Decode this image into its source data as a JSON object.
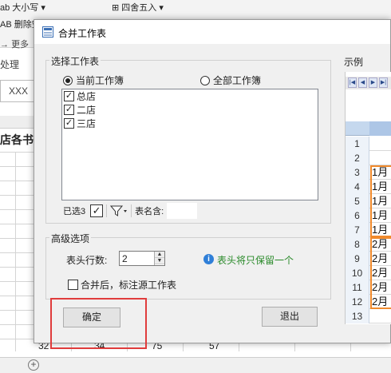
{
  "background": {
    "ribbon": {
      "size_label": "大小写",
      "rounding_label": "四舍五入",
      "delete_label": "删除空",
      "more_label": "更多",
      "process_label": "处理"
    },
    "name_box": "XXX",
    "sheet_title_fragment": "店各书",
    "last_row": [
      "32",
      "34",
      "75",
      "57"
    ]
  },
  "dialog": {
    "title": "合并工作表",
    "select_group": {
      "title": "选择工作表",
      "radio_current": "当前工作簿",
      "radio_all": "全部工作簿",
      "selected_radio": "current",
      "sheets": [
        {
          "label": "总店",
          "checked": true
        },
        {
          "label": "二店",
          "checked": true
        },
        {
          "label": "三店",
          "checked": true
        }
      ],
      "selected_count": "已选3",
      "filter_label": "表名含:",
      "filter_value": ""
    },
    "advanced_group": {
      "title": "高级选项",
      "header_rows_label": "表头行数:",
      "header_rows_value": "2",
      "info_text": "表头将只保留一个",
      "annotate_label": "合并后，标注源工作表",
      "annotate_checked": false
    },
    "ok_label": "确定",
    "exit_label": "退出",
    "example": {
      "title": "示例",
      "rows": [
        {
          "n": "1",
          "v": ""
        },
        {
          "n": "2",
          "v": ""
        },
        {
          "n": "3",
          "v": "1月"
        },
        {
          "n": "4",
          "v": "1月"
        },
        {
          "n": "5",
          "v": "1月"
        },
        {
          "n": "6",
          "v": "1月"
        },
        {
          "n": "7",
          "v": "1月"
        },
        {
          "n": "8",
          "v": "2月"
        },
        {
          "n": "9",
          "v": "2月"
        },
        {
          "n": "10",
          "v": "2月"
        },
        {
          "n": "11",
          "v": "2月"
        },
        {
          "n": "12",
          "v": "2月"
        },
        {
          "n": "13",
          "v": ""
        }
      ]
    }
  }
}
